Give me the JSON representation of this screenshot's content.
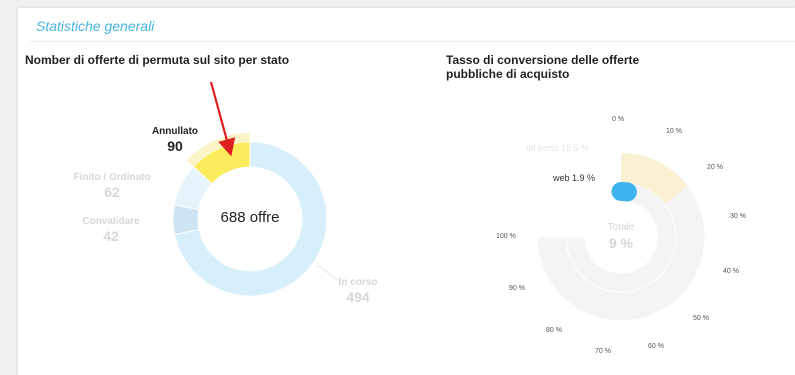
{
  "section": {
    "title": "Statistiche generali"
  },
  "left_chart": {
    "title": "Nomber di offerte di permuta sul sito per stato",
    "center_label": "688 offre",
    "colors": {
      "in_corso": "#d7effb",
      "convalidare": "#cfe4f2",
      "finito": "#e6f3fb",
      "annullato": "#fbec5d"
    },
    "slices": [
      {
        "name": "In corso",
        "value": 494
      },
      {
        "name": "Convalidare",
        "value": 42
      },
      {
        "name": "Finito / Ordinato",
        "value": 62
      },
      {
        "name": "Annullato",
        "value": 90
      }
    ]
  },
  "right_chart": {
    "title": "Tasso di conversione delle offerte pubbliche di acquisto",
    "center_title": "Totale",
    "center_value": "9 %",
    "series": [
      {
        "label": "tel porto 19.5 %",
        "value": 19.5,
        "color": "#faf0d2"
      },
      {
        "label": "web 1.9 %",
        "value": 1.9,
        "color": "#3eb3ee"
      }
    ],
    "scale_ticks": [
      "0 %",
      "10 %",
      "20 %",
      "30 %",
      "40 %",
      "50 %",
      "60 %",
      "70 %",
      "80 %",
      "90 %",
      "100 %"
    ]
  },
  "chart_data": [
    {
      "type": "pie",
      "title": "Nomber di offerte di permuta sul sito per stato",
      "categories": [
        "In corso",
        "Convalidare",
        "Finito / Ordinato",
        "Annullato"
      ],
      "values": [
        494,
        42,
        62,
        90
      ],
      "total_label": "688 offre"
    },
    {
      "type": "bar",
      "title": "Tasso di conversione delle offerte pubbliche di acquisto",
      "categories": [
        "tel porto",
        "web",
        "Totale"
      ],
      "values": [
        19.5,
        1.9,
        9
      ],
      "ylim": [
        0,
        100
      ]
    }
  ]
}
